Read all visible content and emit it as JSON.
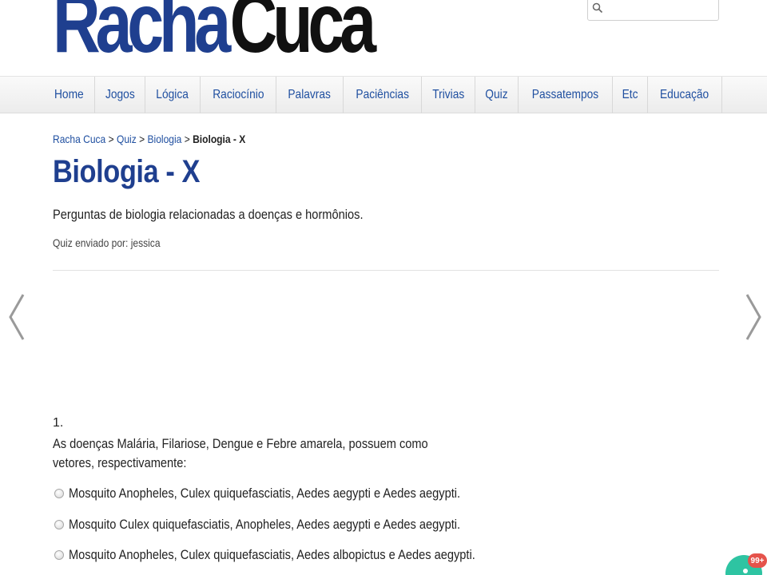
{
  "header": {
    "logo_part1": "Racha",
    "logo_part2": "Cuca",
    "search": {
      "placeholder": "",
      "value": ""
    }
  },
  "nav": {
    "items": [
      "Home",
      "Jogos",
      "Lógica",
      "Raciocínio",
      "Palavras",
      "Paciências",
      "Trivias",
      "Quiz",
      "Passatempos",
      "Etc",
      "Educação"
    ]
  },
  "breadcrumb": {
    "items": [
      "Racha Cuca",
      "Quiz",
      "Biologia"
    ],
    "separator": ">",
    "current": "Biologia - X"
  },
  "page": {
    "title": "Biologia - X",
    "subtitle": "Perguntas de biologia relacionadas a doenças e hormônios.",
    "author": "Quiz enviado por: jessica"
  },
  "question": {
    "number": "1.",
    "text": "As doenças Malária, Filariose, Dengue e Febre amarela, possuem como vetores, respectivamente:",
    "options": [
      "Mosquito Anopheles, Culex quiquefasciatis, Aedes aegypti e Aedes aegypti.",
      "Mosquito Culex quiquefasciatis, Anopheles, Aedes aegypti e Aedes aegypti.",
      "Mosquito Anopheles, Culex quiquefasciatis, Aedes albopictus e Aedes aegypti."
    ]
  },
  "badge": {
    "count": "99+"
  },
  "icons": {
    "search": "search-icon",
    "prev": "chevron-left-icon",
    "next": "chevron-right-icon"
  },
  "colors": {
    "brand_blue": "#1f3f8f",
    "link_blue": "#1f4fa0",
    "badge_green": "#2ec4a2",
    "badge_red": "#e5534b"
  }
}
